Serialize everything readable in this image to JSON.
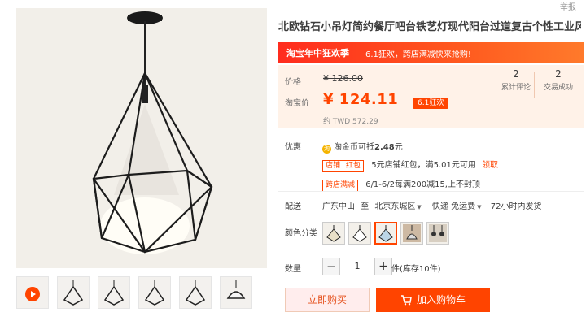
{
  "header": {
    "report_label": "举报"
  },
  "product": {
    "title": "北欧钻石小吊灯简约餐厅吧台铁艺灯现代阳台过道复古个性工业风灯",
    "banner": {
      "event": "淘宝年中狂欢季",
      "subtitle": "6.1狂欢，跨店满减快来抢购!"
    },
    "price": {
      "original_label": "价格",
      "original_value": "¥ 126.00",
      "taobao_label": "淘宝价",
      "taobao_value": "¥ 124.11",
      "promo_tag": "6.1狂欢",
      "twd": "约 TWD 572.29"
    },
    "stats": [
      {
        "value": "2",
        "label": "累计评论"
      },
      {
        "value": "2",
        "label": "交易成功"
      }
    ],
    "promos": {
      "label": "优惠",
      "coin_icon_text": "淘",
      "coin_text": "淘金币可抵",
      "coin_amount": "2.48",
      "coin_unit": "元",
      "shop_badge_1": "店铺",
      "shop_badge_2": "红包",
      "shop_text": "5元店铺红包，满5.01元可用",
      "shop_link": "领取",
      "cross_badge": "跨店满减",
      "cross_text": "6/1-6/2每满200减15,上不封顶"
    },
    "delivery": {
      "label": "配送",
      "from": "广东中山",
      "to_word": "至",
      "destination": "北京东城区",
      "shipping": "快递 免运费",
      "time": "72小时内发货"
    },
    "color_label": "颜色分类",
    "quantity": {
      "label": "数量",
      "minus": "−",
      "value": "1",
      "plus": "+",
      "stock": "件(库存10件)"
    },
    "actions": {
      "buy": "立即购买",
      "cart": "加入购物车"
    }
  },
  "colors": {
    "accent": "#ff4400",
    "banner": "#ff2c1e",
    "price_bg": "#fff2e8"
  }
}
